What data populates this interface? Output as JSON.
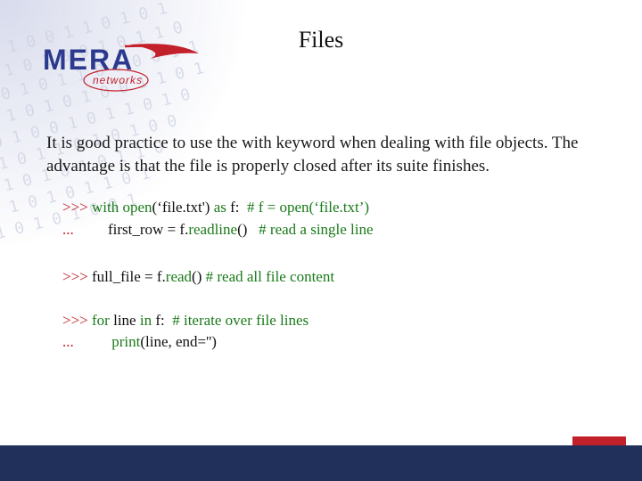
{
  "title": "Files",
  "logo": {
    "main": "MERA",
    "sub": "networks"
  },
  "paragraph": "It is good practice to use the with keyword when dealing with file objects. The advantage is that the file is properly closed after its suite finishes.",
  "code_block1": {
    "l1": {
      "prompt": ">>> ",
      "kw1": "with ",
      "fn": "open",
      "plain1": "(‘file.txt') ",
      "kw2": "as ",
      "plain2": "f:  ",
      "comment": "# f = open(‘file.txt’)"
    },
    "l2": {
      "prompt": "...         ",
      "plain1": "first_row = f.",
      "fn": "readline",
      "plain2": "()   ",
      "comment": "# read a single line"
    }
  },
  "code_block2": {
    "l1": {
      "prompt": ">>> ",
      "plain1": "full_file = f.",
      "fn": "read",
      "plain2": "() ",
      "comment": "# read all file content"
    },
    "spacer": " ",
    "l2": {
      "prompt": ">>> ",
      "kw1": "for ",
      "plain1": "line ",
      "kw2": "in ",
      "plain2": "f:  ",
      "comment": "# iterate over file lines"
    },
    "l3": {
      "prompt": "...          ",
      "fn": "print",
      "plain": "(line, end='')"
    }
  },
  "colors": {
    "accent_red": "#c2202b",
    "accent_blue": "#20305a",
    "kw_green": "#1a7a1a"
  }
}
